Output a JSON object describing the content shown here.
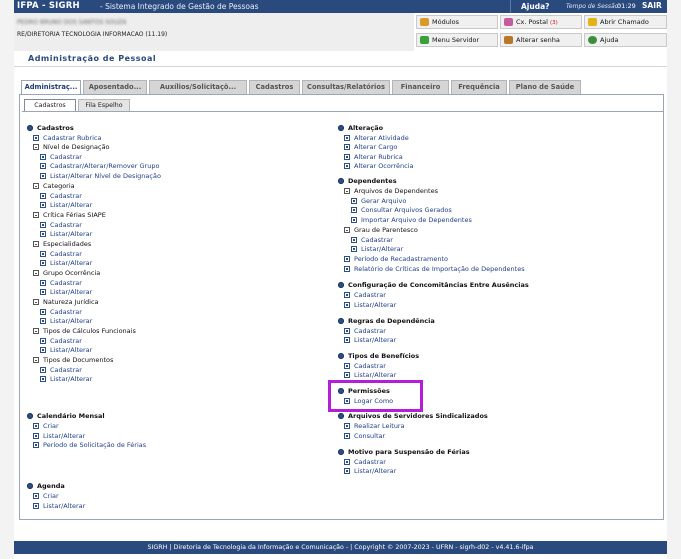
{
  "header": {
    "brand": "IFPA - SIGRH",
    "system_name": "- Sistema Integrado de Gestão de Pessoas",
    "help_label": "Ajuda?",
    "session_label": "Tempo de Sessão:",
    "session_time": "01:29",
    "logout_label": "SAIR"
  },
  "user": {
    "name": "PEDRO BRUNO DOS SANTOS SOUZA",
    "unit": "RE/DIRETORIA TECNOLOGIA INFORMACAO (11.19)"
  },
  "top_menu": {
    "modulos": "Módulos",
    "caixa_postal": "Cx. Postal",
    "caixa_count": "(3)",
    "abrir_chamado": "Abrir Chamado",
    "menu_servidor": "Menu Servidor",
    "alterar_senha": "Alterar senha",
    "ajuda": "Ajuda"
  },
  "section_title": "Administração de Pessoal",
  "tabs": [
    "Administraç...",
    "Aposentado...",
    "Auxílios/Solicitaçõ...",
    "Cadastros",
    "Consultas/Relatórios",
    "Financeiro",
    "Frequência",
    "Plano de Saúde"
  ],
  "subtabs": [
    "Cadastros",
    "Fila Espelho"
  ],
  "left": {
    "cadastros": "Cadastros",
    "cadastrar_rubrica": "Cadastrar Rubrica",
    "nivel_designacao": "Nível de Designação",
    "nd_cadastrar": "Cadastrar",
    "nd_grupo": "Cadastrar/Alterar/Remover Grupo",
    "nd_listar": "Listar/Alterar Nível de Designação",
    "categoria": "Categoria",
    "cat_cadastrar": "Cadastrar",
    "cat_listar": "Listar/Alterar",
    "critica_ferias": "Crítica Férias SIAPE",
    "cf_cadastrar": "Cadastrar",
    "cf_listar": "Listar/Alterar",
    "especialidades": "Especialidades",
    "esp_cadastrar": "Cadastrar",
    "esp_listar": "Listar/Alterar",
    "grupo_ocorrencia": "Grupo Ocorrência",
    "go_cadastrar": "Cadastrar",
    "go_listar": "Listar/Alterar",
    "natureza_juridica": "Natureza Jurídica",
    "nj_cadastrar": "Cadastrar",
    "nj_listar": "Listar/Alterar",
    "tipos_calculos": "Tipos de Cálculos Funcionais",
    "tc_cadastrar": "Cadastrar",
    "tc_listar": "Listar/Alterar",
    "tipos_documentos": "Tipos de Documentos",
    "td_cadastrar": "Cadastrar",
    "td_listar": "Listar/Alterar",
    "calendario": "Calendário Mensal",
    "cal_criar": "Criar",
    "cal_listar": "Listar/Alterar",
    "cal_periodo": "Período de Solicitação de Férias",
    "agenda": "Agenda",
    "ag_criar": "Criar",
    "ag_listar": "Listar/Alterar"
  },
  "right": {
    "alteracao": "Alteração",
    "alt_atividade": "Alterar Atividade",
    "alt_cargo": "Alterar Cargo",
    "alt_rubrica": "Alterar Rubrica",
    "alt_ocorrencia": "Alterar Ocorrência",
    "dependentes": "Dependentes",
    "arq_dependentes": "Arquivos de Dependentes",
    "gerar_arquivo": "Gerar Arquivo",
    "consultar_arquivos": "Consultar Arquivos Gerados",
    "importar_arquivo": "Importar Arquivo de Dependentes",
    "grau_parentesco": "Grau de Parentesco",
    "gp_cadastrar": "Cadastrar",
    "gp_listar": "Listar/Alterar",
    "periodo_recadastramento": "Período de Recadastramento",
    "relatorio_criticas": "Relatório de Críticas de Importação de Dependentes",
    "config_concomitancias": "Configuração de Concomitâncias Entre Ausências",
    "cc_cadastrar": "Cadastrar",
    "cc_listar": "Listar/Alterar",
    "regras_dependencia": "Regras de Dependência",
    "rd_cadastrar": "Cadastrar",
    "rd_listar": "Listar/Alterar",
    "tipos_beneficios": "Tipos de Benefícios",
    "tb_cadastrar": "Cadastrar",
    "tb_listar": "Listar/Alterar",
    "permissoes": "Permissões",
    "logar_como": "Logar Como",
    "arquivos_sindicalizados": "Arquivos de Servidores Sindicalizados",
    "as_realizar": "Realizar Leitura",
    "as_consultar": "Consultar",
    "motivo_suspensao": "Motivo para Suspensão de Férias",
    "ms_cadastrar": "Cadastrar",
    "ms_listar": "Listar/Alterar"
  },
  "footer": "SIGRH | Diretoria de Tecnologia da Informação e Comunicação - | Copyright © 2007-2023 - UFRN - sigrh-d02 - v4.41.6-ifpa"
}
